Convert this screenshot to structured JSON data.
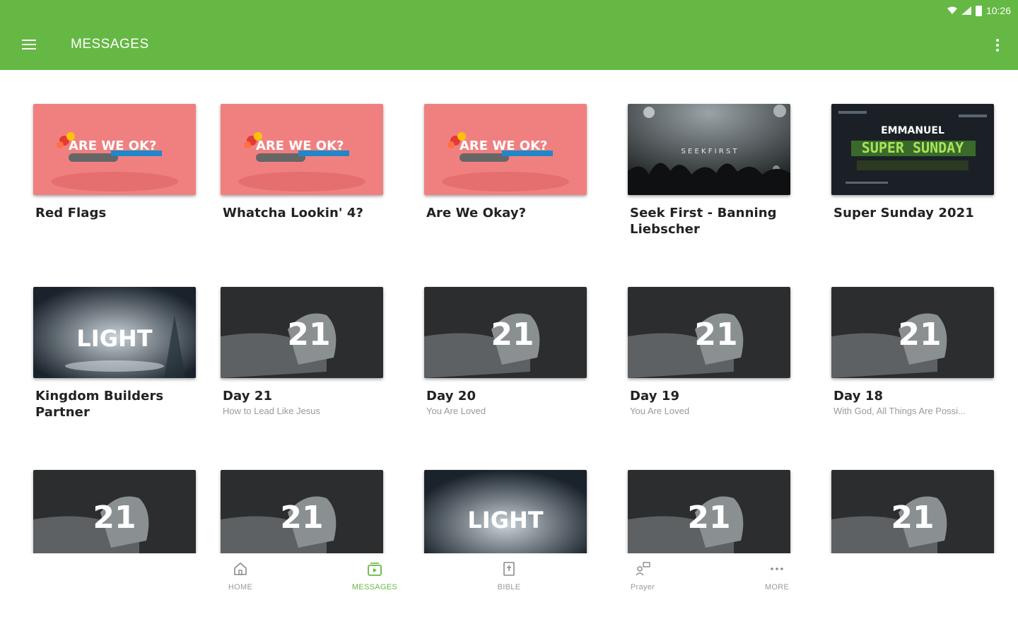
{
  "status_bar": {
    "time": "10:26"
  },
  "app_bar": {
    "title": "MESSAGES"
  },
  "thumb_text": {
    "are_we_ok": "ARE WE OK?",
    "seek_first": "S E E K   F I R S T",
    "emmanuel": "EMMANUEL",
    "super_sunday": "SUPER SUNDAY",
    "light": "LIGHT",
    "light_small": "LIGHT",
    "twentyone": "21"
  },
  "messages": [
    {
      "title": "Red Flags",
      "subtitle": "",
      "thumb": "are-we-ok"
    },
    {
      "title": "Whatcha Lookin' 4?",
      "subtitle": "",
      "thumb": "are-we-ok"
    },
    {
      "title": "Are We Okay?",
      "subtitle": "",
      "thumb": "are-we-ok"
    },
    {
      "title": "Seek First - Banning Liebscher",
      "subtitle": "",
      "thumb": "seek-first"
    },
    {
      "title": "Super Sunday 2021",
      "subtitle": "",
      "thumb": "super-sunday"
    },
    {
      "title": "Kingdom Builders Partner",
      "subtitle": "",
      "thumb": "light"
    },
    {
      "title": "Day 21",
      "subtitle": "How to Lead Like Jesus",
      "thumb": "21-days"
    },
    {
      "title": "Day 20",
      "subtitle": "You Are Loved",
      "thumb": "21-days"
    },
    {
      "title": "Day 19",
      "subtitle": "You Are Loved",
      "thumb": "21-days"
    },
    {
      "title": "Day 18",
      "subtitle": "With God, All Things Are Possi...",
      "thumb": "21-days"
    },
    {
      "title": "",
      "subtitle": "",
      "thumb": "21-days"
    },
    {
      "title": "",
      "subtitle": "",
      "thumb": "21-days"
    },
    {
      "title": "",
      "subtitle": "",
      "thumb": "light"
    },
    {
      "title": "",
      "subtitle": "",
      "thumb": "21-days"
    },
    {
      "title": "",
      "subtitle": "",
      "thumb": "21-days"
    }
  ],
  "bottom_nav": {
    "active": "messages",
    "items": [
      {
        "label": "HOME",
        "icon": "home-icon"
      },
      {
        "label": "MESSAGES",
        "icon": "messages-icon"
      },
      {
        "label": "BIBLE",
        "icon": "bible-icon"
      },
      {
        "label": "Prayer",
        "icon": "prayer-icon"
      },
      {
        "label": "MORE",
        "icon": "more-icon"
      }
    ]
  },
  "colors": {
    "accent": "#65b844",
    "inactive": "#9a9a9a",
    "text": "#222222"
  }
}
